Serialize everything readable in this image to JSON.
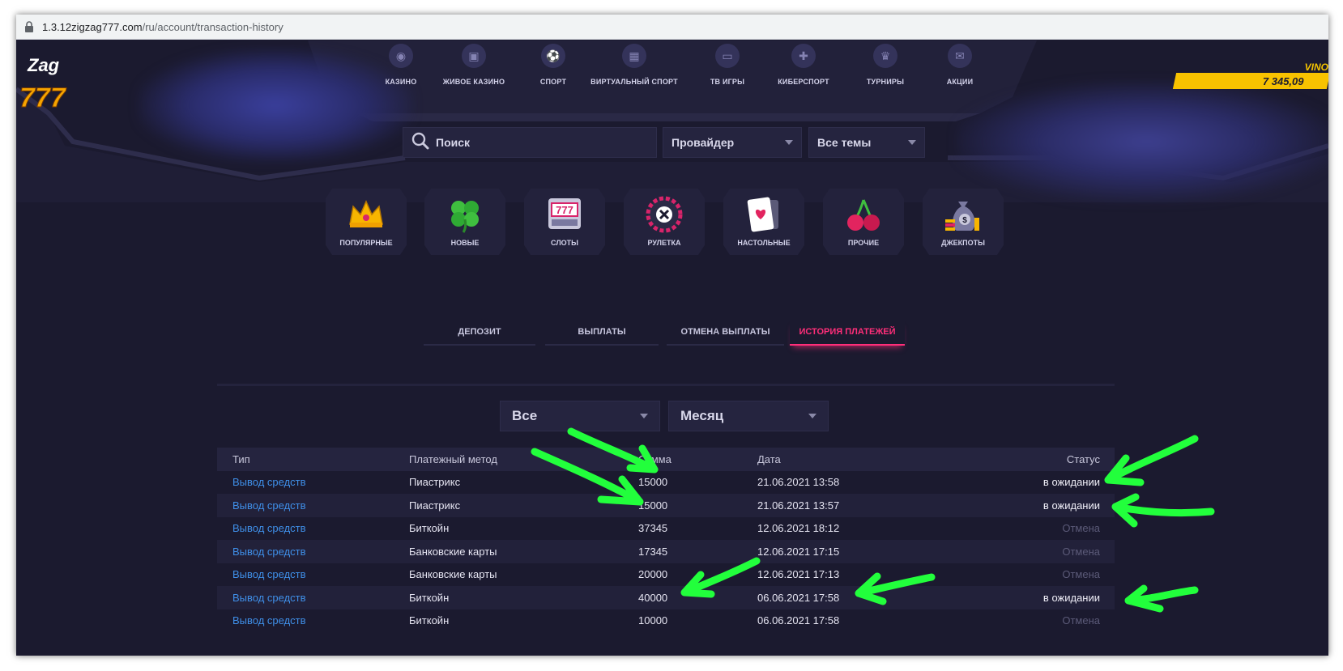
{
  "browser": {
    "url_host": "1.3.12zigzag777.com",
    "url_path": "/ru/account/transaction-history"
  },
  "brand": {
    "logo_top": "Zag",
    "logo_bottom": "777"
  },
  "balance": {
    "user": "VINO",
    "amount": "7 345,09"
  },
  "nav": [
    {
      "label": "КАЗИНО",
      "icon": "roulette-icon"
    },
    {
      "label": "ЖИВОЕ КАЗИНО",
      "icon": "live-icon"
    },
    {
      "label": "СПОРТ",
      "icon": "ball-icon"
    },
    {
      "label": "ВИРТУАЛЬНЫЙ СПОРТ",
      "icon": "field-icon"
    },
    {
      "label": "ТВ ИГРЫ",
      "icon": "tv-icon"
    },
    {
      "label": "КИБЕРСПОРТ",
      "icon": "gamepad-icon"
    },
    {
      "label": "ТУРНИРЫ",
      "icon": "trophy-icon"
    },
    {
      "label": "АКЦИИ",
      "icon": "gift-icon"
    }
  ],
  "search": {
    "placeholder": "Поиск"
  },
  "filters_top": {
    "provider": "Провайдер",
    "themes": "Все темы"
  },
  "categories": [
    {
      "label": "ПОПУЛЯРНЫЕ",
      "icon": "crown-icon"
    },
    {
      "label": "НОВЫЕ",
      "icon": "clover-icon"
    },
    {
      "label": "СЛОТЫ",
      "icon": "slot-machine-icon"
    },
    {
      "label": "РУЛЕТКА",
      "icon": "roulette-wheel-icon"
    },
    {
      "label": "НАСТОЛЬНЫЕ",
      "icon": "playing-card-icon"
    },
    {
      "label": "ПРОЧИЕ",
      "icon": "cherry-icon"
    },
    {
      "label": "ДЖЕКПОТЫ",
      "icon": "money-bag-icon"
    }
  ],
  "tabs": [
    {
      "label": "ДЕПОЗИТ"
    },
    {
      "label": "ВЫПЛАТЫ"
    },
    {
      "label": "ОТМЕНА ВЫПЛАТЫ"
    },
    {
      "label": "ИСТОРИЯ ПЛАТЕЖЕЙ",
      "active": true
    }
  ],
  "history_filters": {
    "type": "Все",
    "period": "Месяц"
  },
  "table": {
    "headers": [
      "Тип",
      "Платежный метод",
      "Сумма",
      "Дата",
      "Статус"
    ],
    "rows": [
      {
        "type": "Вывод средств",
        "method": "Пиастрикс",
        "amount": "15000",
        "date": "21.06.2021 13:58",
        "status": "в ожидании",
        "state": "pending"
      },
      {
        "type": "Вывод средств",
        "method": "Пиастрикс",
        "amount": "15000",
        "date": "21.06.2021 13:57",
        "status": "в ожидании",
        "state": "pending"
      },
      {
        "type": "Вывод средств",
        "method": "Биткойн",
        "amount": "37345",
        "date": "12.06.2021 18:12",
        "status": "Отмена",
        "state": "cancel"
      },
      {
        "type": "Вывод средств",
        "method": "Банковские карты",
        "amount": "17345",
        "date": "12.06.2021 17:15",
        "status": "Отмена",
        "state": "cancel"
      },
      {
        "type": "Вывод средств",
        "method": "Банковские карты",
        "amount": "20000",
        "date": "12.06.2021 17:13",
        "status": "Отмена",
        "state": "cancel"
      },
      {
        "type": "Вывод средств",
        "method": "Биткойн",
        "amount": "40000",
        "date": "06.06.2021 17:58",
        "status": "в ожидании",
        "state": "pending"
      },
      {
        "type": "Вывод средств",
        "method": "Биткойн",
        "amount": "10000",
        "date": "06.06.2021 17:58",
        "status": "Отмена",
        "state": "cancel"
      }
    ]
  },
  "colors": {
    "background": "#1b1a2f",
    "accent": "#ff2e79",
    "link": "#3f8fe8",
    "balance": "#f8c200",
    "annotation": "#22ff3c"
  }
}
